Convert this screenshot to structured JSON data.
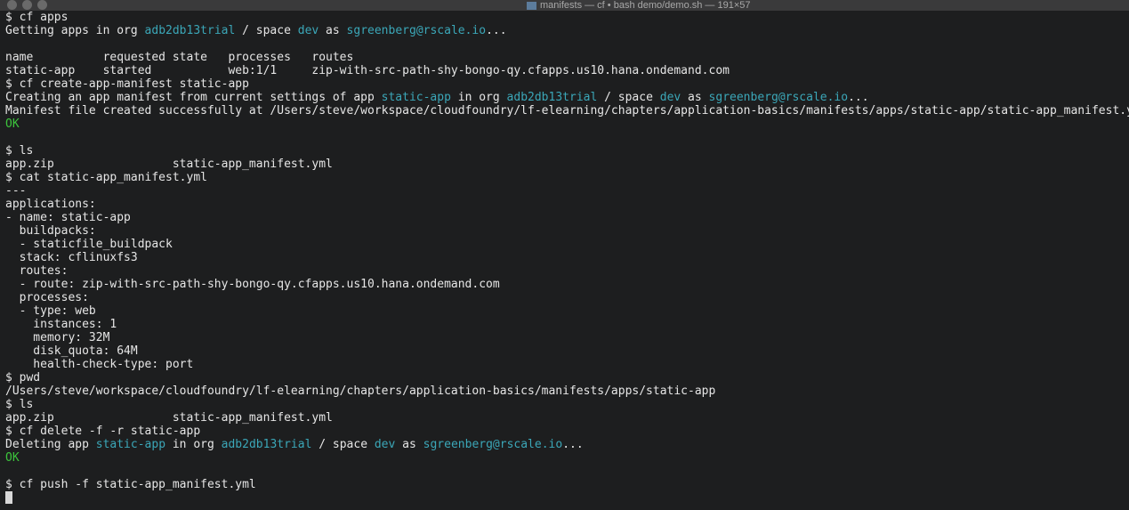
{
  "window": {
    "title": "manifests — cf • bash demo/demo.sh — 191×57"
  },
  "colors": {
    "background": "#1d1e1f",
    "text": "#e6e6e6",
    "highlight": "#3ba7b8",
    "ok": "#3cc43c"
  },
  "terminal": {
    "lines": [
      [
        {
          "t": "$ cf apps"
        }
      ],
      [
        {
          "t": "Getting apps in org "
        },
        {
          "t": "adb2db13trial",
          "c": "c"
        },
        {
          "t": " / space "
        },
        {
          "t": "dev",
          "c": "c"
        },
        {
          "t": " as "
        },
        {
          "t": "sgreenberg@rscale.io",
          "c": "c"
        },
        {
          "t": "..."
        }
      ],
      [],
      [
        {
          "t": "name          requested state   processes   routes"
        }
      ],
      [
        {
          "t": "static-app    started           web:1/1     zip-with-src-path-shy-bongo-qy.cfapps.us10.hana.ondemand.com"
        }
      ],
      [
        {
          "t": "$ cf create-app-manifest static-app"
        }
      ],
      [
        {
          "t": "Creating an app manifest from current settings of app "
        },
        {
          "t": "static-app",
          "c": "c"
        },
        {
          "t": " in org "
        },
        {
          "t": "adb2db13trial",
          "c": "c"
        },
        {
          "t": " / space "
        },
        {
          "t": "dev",
          "c": "c"
        },
        {
          "t": " as "
        },
        {
          "t": "sgreenberg@rscale.io",
          "c": "c"
        },
        {
          "t": "..."
        }
      ],
      [
        {
          "t": "Manifest file created successfully at /Users/steve/workspace/cloudfoundry/lf-elearning/chapters/application-basics/manifests/apps/static-app/static-app_manifest.yml"
        }
      ],
      [
        {
          "t": "OK",
          "c": "g"
        }
      ],
      [],
      [
        {
          "t": "$ ls"
        }
      ],
      [
        {
          "t": "app.zip                 static-app_manifest.yml"
        }
      ],
      [
        {
          "t": "$ cat static-app_manifest.yml"
        }
      ],
      [
        {
          "t": "---"
        }
      ],
      [
        {
          "t": "applications:"
        }
      ],
      [
        {
          "t": "- name: static-app"
        }
      ],
      [
        {
          "t": "  buildpacks:"
        }
      ],
      [
        {
          "t": "  - staticfile_buildpack"
        }
      ],
      [
        {
          "t": "  stack: cflinuxfs3"
        }
      ],
      [
        {
          "t": "  routes:"
        }
      ],
      [
        {
          "t": "  - route: zip-with-src-path-shy-bongo-qy.cfapps.us10.hana.ondemand.com"
        }
      ],
      [
        {
          "t": "  processes:"
        }
      ],
      [
        {
          "t": "  - type: web"
        }
      ],
      [
        {
          "t": "    instances: 1"
        }
      ],
      [
        {
          "t": "    memory: 32M"
        }
      ],
      [
        {
          "t": "    disk_quota: 64M"
        }
      ],
      [
        {
          "t": "    health-check-type: port"
        }
      ],
      [
        {
          "t": "$ pwd"
        }
      ],
      [
        {
          "t": "/Users/steve/workspace/cloudfoundry/lf-elearning/chapters/application-basics/manifests/apps/static-app"
        }
      ],
      [
        {
          "t": "$ ls"
        }
      ],
      [
        {
          "t": "app.zip                 static-app_manifest.yml"
        }
      ],
      [
        {
          "t": "$ cf delete -f -r static-app"
        }
      ],
      [
        {
          "t": "Deleting app "
        },
        {
          "t": "static-app",
          "c": "c"
        },
        {
          "t": " in org "
        },
        {
          "t": "adb2db13trial",
          "c": "c"
        },
        {
          "t": " / space "
        },
        {
          "t": "dev",
          "c": "c"
        },
        {
          "t": " as "
        },
        {
          "t": "sgreenberg@rscale.io",
          "c": "c"
        },
        {
          "t": "..."
        }
      ],
      [
        {
          "t": "OK",
          "c": "g"
        }
      ],
      [],
      [
        {
          "t": "$ cf push -f static-app_manifest.yml"
        }
      ]
    ]
  }
}
